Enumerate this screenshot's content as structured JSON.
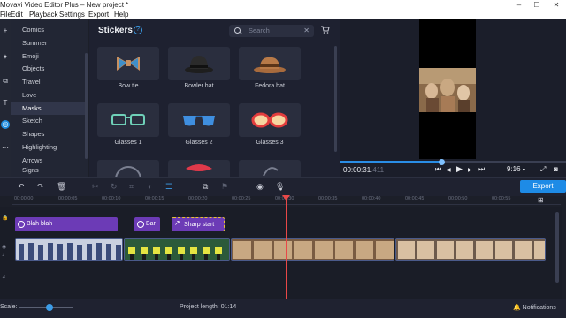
{
  "window": {
    "title": "Movavi Video Editor Plus – New project *",
    "minimize": "–",
    "maximize": "☐",
    "close": "✕"
  },
  "menu": [
    "File",
    "Edit",
    "Playback",
    "Settings",
    "Export",
    "Help"
  ],
  "tools": [
    "import-icon",
    "filters-icon",
    "transitions-icon",
    "titles-icon",
    "stickers-icon",
    "more-icon"
  ],
  "categories": [
    "Comics",
    "Summer",
    "Emoji",
    "Objects",
    "Travel",
    "Love",
    "Masks",
    "Sketch",
    "Shapes",
    "Highlighting",
    "Arrows",
    "Signs"
  ],
  "active_category": "Masks",
  "stickers_panel": {
    "title": "Stickers",
    "help": "?",
    "search_placeholder": "Search",
    "clear": "✕",
    "cart": "🛒"
  },
  "stickers": [
    {
      "label": "Bow tie",
      "icon": "bow-tie-icon"
    },
    {
      "label": "Bowler hat",
      "icon": "bowler-hat-icon"
    },
    {
      "label": "Fedora hat",
      "icon": "fedora-hat-icon"
    },
    {
      "label": "Glasses 1",
      "icon": "glasses-1-icon"
    },
    {
      "label": "Glasses 2",
      "icon": "glasses-2-icon"
    },
    {
      "label": "Glasses 3",
      "icon": "glasses-3-icon"
    }
  ],
  "preview": {
    "time_main": "00:00:31",
    "time_frac": ".411",
    "aspect": "9:16",
    "aspect_caret": "▾",
    "progress": 0.45,
    "controls": {
      "prev": "⏮",
      "step_back": "◀",
      "play": "▶",
      "step_fwd": "▶",
      "next": "⏭"
    }
  },
  "toolbar": {
    "export_label": "Export"
  },
  "ruler": [
    "00:00:00",
    "00:00:05",
    "00:00:10",
    "00:00:15",
    "00:00:20",
    "00:00:25",
    "00:00:30",
    "00:00:35",
    "00:00:40",
    "00:00:45",
    "00:00:50",
    "00:00:55"
  ],
  "title_clips": [
    {
      "label": "Blah blah"
    },
    {
      "label": "Bar"
    },
    {
      "label": "Sharp start"
    }
  ],
  "status": {
    "scale_label": "Scale:",
    "project_length": "Project length:  01:14",
    "notifications": "Notifications"
  },
  "colors": {
    "accent": "#1e8be6",
    "title_clip": "#6c3bb6",
    "selection": "#e8c233",
    "playhead": "#e84848"
  }
}
